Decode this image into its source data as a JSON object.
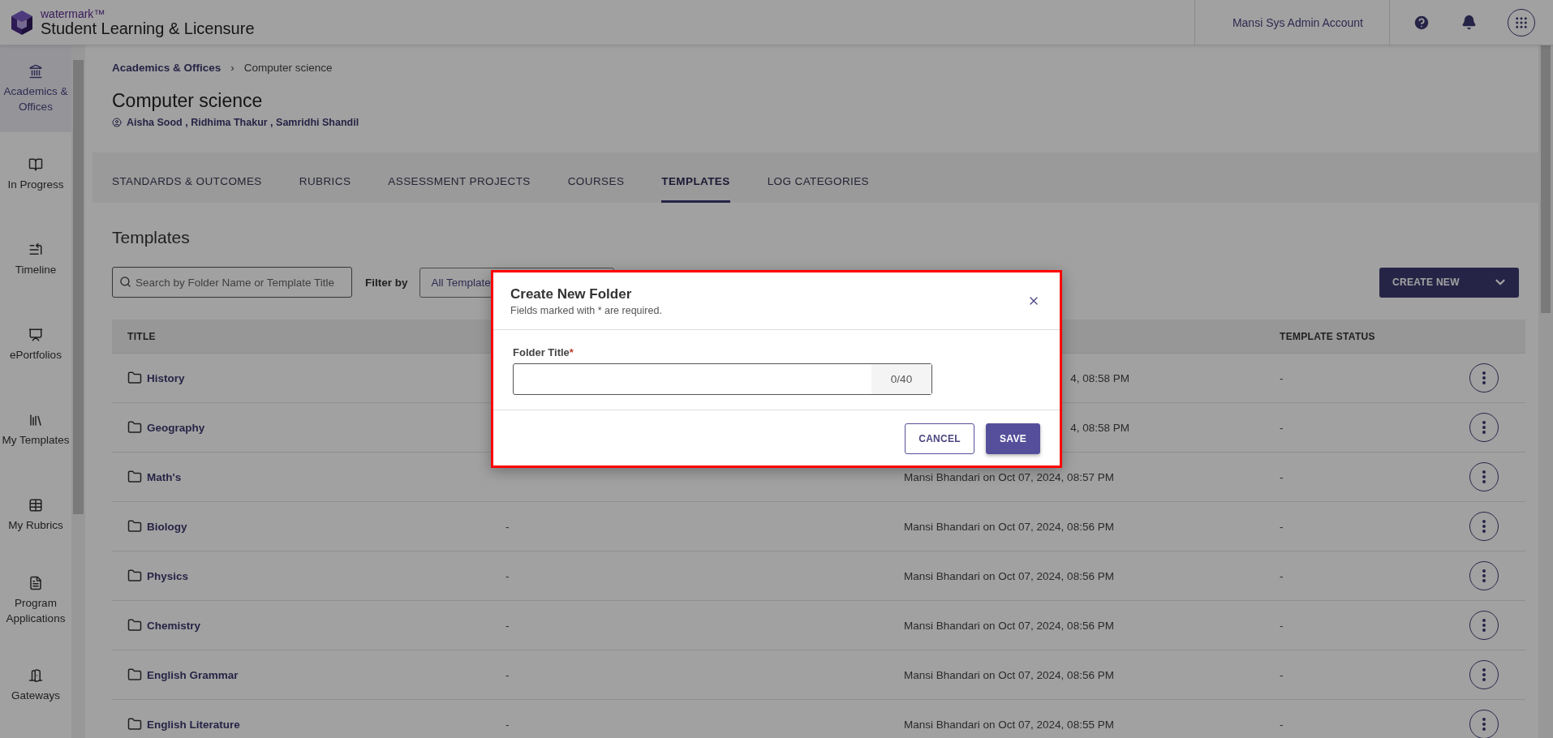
{
  "app": {
    "brand": "watermark™",
    "product": "Student Learning & Licensure"
  },
  "header": {
    "account": "Mansi Sys Admin Account"
  },
  "sidebar": {
    "items": [
      {
        "label": "Academics & Offices",
        "selected": true
      },
      {
        "label": "In Progress",
        "selected": false
      },
      {
        "label": "Timeline",
        "selected": false
      },
      {
        "label": "ePortfolios",
        "selected": false
      },
      {
        "label": "My Templates",
        "selected": false
      },
      {
        "label": "My Rubrics",
        "selected": false
      },
      {
        "label": "Program Applications",
        "selected": false
      },
      {
        "label": "Gateways",
        "selected": false
      }
    ]
  },
  "breadcrumb": {
    "items": [
      "Academics & Offices",
      "Computer science"
    ],
    "separator": "›"
  },
  "page": {
    "title": "Computer science",
    "members": "Aisha Sood , Ridhima Thakur , Samridhi Shandil"
  },
  "tabs": [
    {
      "label": "STANDARDS & OUTCOMES",
      "selected": false
    },
    {
      "label": "RUBRICS",
      "selected": false
    },
    {
      "label": "ASSESSMENT PROJECTS",
      "selected": false
    },
    {
      "label": "COURSES",
      "selected": false
    },
    {
      "label": "TEMPLATES",
      "selected": true
    },
    {
      "label": "LOG CATEGORIES",
      "selected": false
    }
  ],
  "section_title": "Templates",
  "search": {
    "placeholder": "Search by Folder Name or Template Title"
  },
  "filter": {
    "label": "Filter by",
    "value": "All Template"
  },
  "create_button": "CREATE NEW",
  "table": {
    "columns": [
      "TITLE",
      "TEMPLATE STATUS"
    ],
    "rows": [
      {
        "title": "History",
        "covered": true,
        "column_3": "4, 08:58 PM",
        "status": "-"
      },
      {
        "title": "Geography",
        "covered": true,
        "column_3": "4, 08:58 PM",
        "status": "-"
      },
      {
        "title": "Math's",
        "covered": false,
        "column_3": "Mansi Bhandari on Oct 07, 2024, 08:57 PM",
        "status": "-"
      },
      {
        "title": "Biology",
        "covered": false,
        "column_2": "-",
        "column_3": "Mansi Bhandari on Oct 07, 2024, 08:56 PM",
        "status": "-"
      },
      {
        "title": "Physics",
        "covered": false,
        "column_2": "-",
        "column_3": "Mansi Bhandari on Oct 07, 2024, 08:56 PM",
        "status": "-"
      },
      {
        "title": "Chemistry",
        "covered": false,
        "column_2": "-",
        "column_3": "Mansi Bhandari on Oct 07, 2024, 08:56 PM",
        "status": "-"
      },
      {
        "title": "English Grammar",
        "covered": false,
        "column_2": "-",
        "column_3": "Mansi Bhandari on Oct 07, 2024, 08:56 PM",
        "status": "-"
      },
      {
        "title": "English Literature",
        "covered": false,
        "column_2": "-",
        "column_3": "Mansi Bhandari on Oct 07, 2024, 08:55 PM",
        "status": "-"
      }
    ]
  },
  "modal": {
    "title": "Create New Folder",
    "subtitle": "Fields marked with * are required.",
    "field": {
      "label": "Folder Title",
      "required_mark": "*",
      "counter": "0/40"
    },
    "buttons": [
      {
        "label": "CANCEL",
        "kind": "secondary"
      },
      {
        "label": "SAVE",
        "kind": "primary"
      }
    ]
  }
}
